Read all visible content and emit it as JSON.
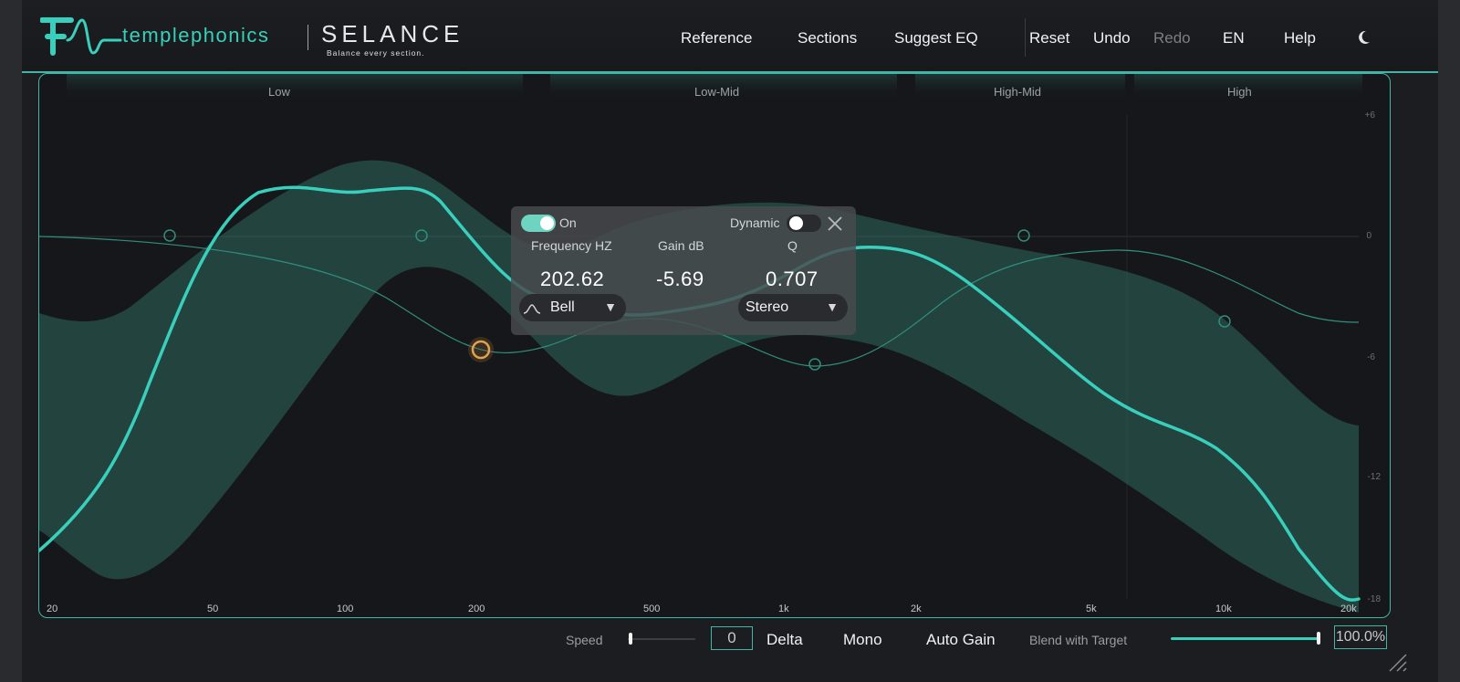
{
  "brand": {
    "name": "templephonics",
    "product": "SELANCE",
    "tagline": "Balance every section.",
    "accent": "#38d0bc"
  },
  "nav": {
    "reference": "Reference",
    "sections": "Sections",
    "suggest_eq": "Suggest EQ",
    "reset": "Reset",
    "undo": "Undo",
    "redo": "Redo",
    "language": "EN",
    "help": "Help",
    "theme_icon": "moon-icon"
  },
  "sections": [
    "Low",
    "Low-Mid",
    "High-Mid",
    "High"
  ],
  "freq_ticks": [
    "20",
    "50",
    "100",
    "200",
    "500",
    "1k",
    "2k",
    "5k",
    "10k",
    "20k"
  ],
  "db_ticks": [
    "+6",
    "0",
    "-6",
    "-12",
    "-18"
  ],
  "band_popup": {
    "on_label": "On",
    "on": true,
    "dynamic_label": "Dynamic",
    "dynamic": false,
    "freq_label": "Frequency HZ",
    "freq_value": "202.62",
    "gain_label": "Gain dB",
    "gain_value": "-5.69",
    "q_label": "Q",
    "q_value": "0.707",
    "shape": "Bell",
    "channel": "Stereo"
  },
  "footer": {
    "speed_label": "Speed",
    "speed_value": "0",
    "delta": "Delta",
    "mono": "Mono",
    "auto_gain": "Auto Gain",
    "blend_label": "Blend with Target",
    "blend_value": "100.0%",
    "blend": 1.0
  }
}
